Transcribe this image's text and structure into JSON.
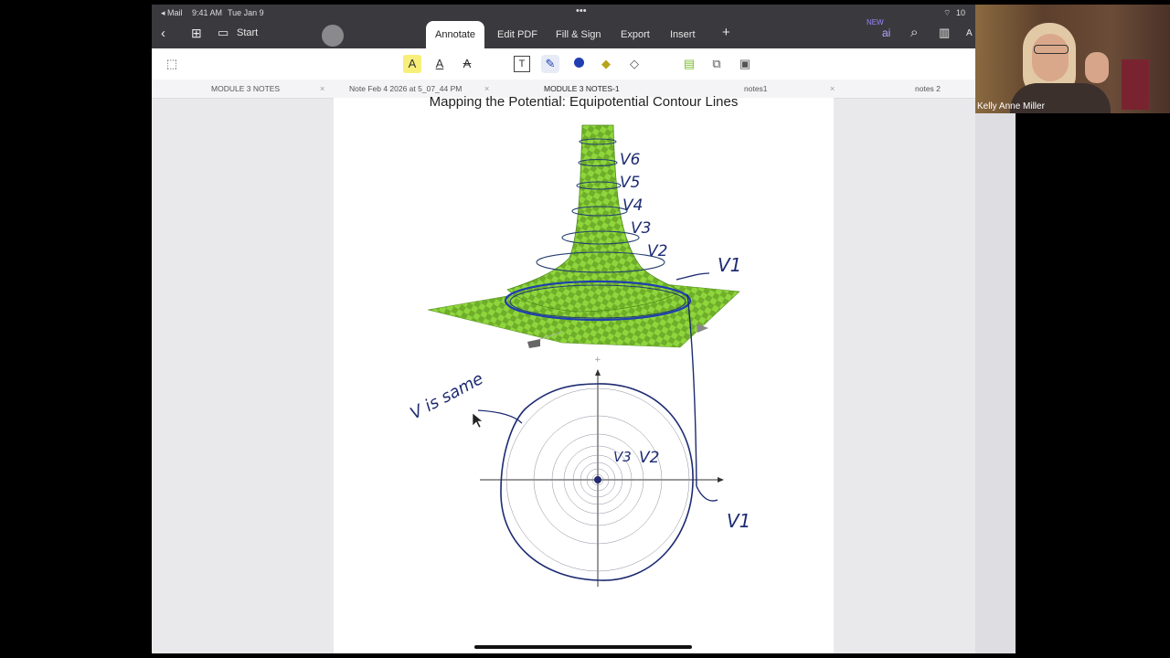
{
  "status_bar": {
    "back_app": "◂ Mail",
    "time": "9:41 AM",
    "date": "Tue Jan 9",
    "battery": "10"
  },
  "toolbar": {
    "start_label": "Start",
    "tabs": [
      {
        "label": "Annotate",
        "active": true
      },
      {
        "label": "Edit PDF",
        "active": false
      },
      {
        "label": "Fill & Sign",
        "active": false
      },
      {
        "label": "Export",
        "active": false
      },
      {
        "label": "Insert",
        "active": false
      }
    ],
    "add_label": "+",
    "new_badge": "NEW"
  },
  "doc_tabs": [
    {
      "label": "MODULE 3 NOTES",
      "active": false
    },
    {
      "label": "Note Feb 4 2026 at 5_07_44 PM",
      "active": false
    },
    {
      "label": "MODULE 3 NOTES-1",
      "active": true
    },
    {
      "label": "notes1",
      "active": false
    },
    {
      "label": "notes 2",
      "active": false
    }
  ],
  "page": {
    "title": "Mapping the Potential: Equipotential Contour Lines",
    "handwriting": {
      "v6": "V6",
      "v5": "V5",
      "v4": "V4",
      "v3": "V3",
      "v2": "V2",
      "v1": "V1",
      "v_is_same": "V is same",
      "v3_lower": "V3",
      "v2_lower": "V2",
      "v1_lower": "V1"
    }
  },
  "webcam": {
    "name": "Kelly Anne Miller"
  },
  "colors": {
    "toolbar_bg": "#3a3a3e",
    "surface_green": "#8fd63c",
    "ink_blue": "#1d2b72",
    "accent_blue": "#1f3fb0"
  }
}
